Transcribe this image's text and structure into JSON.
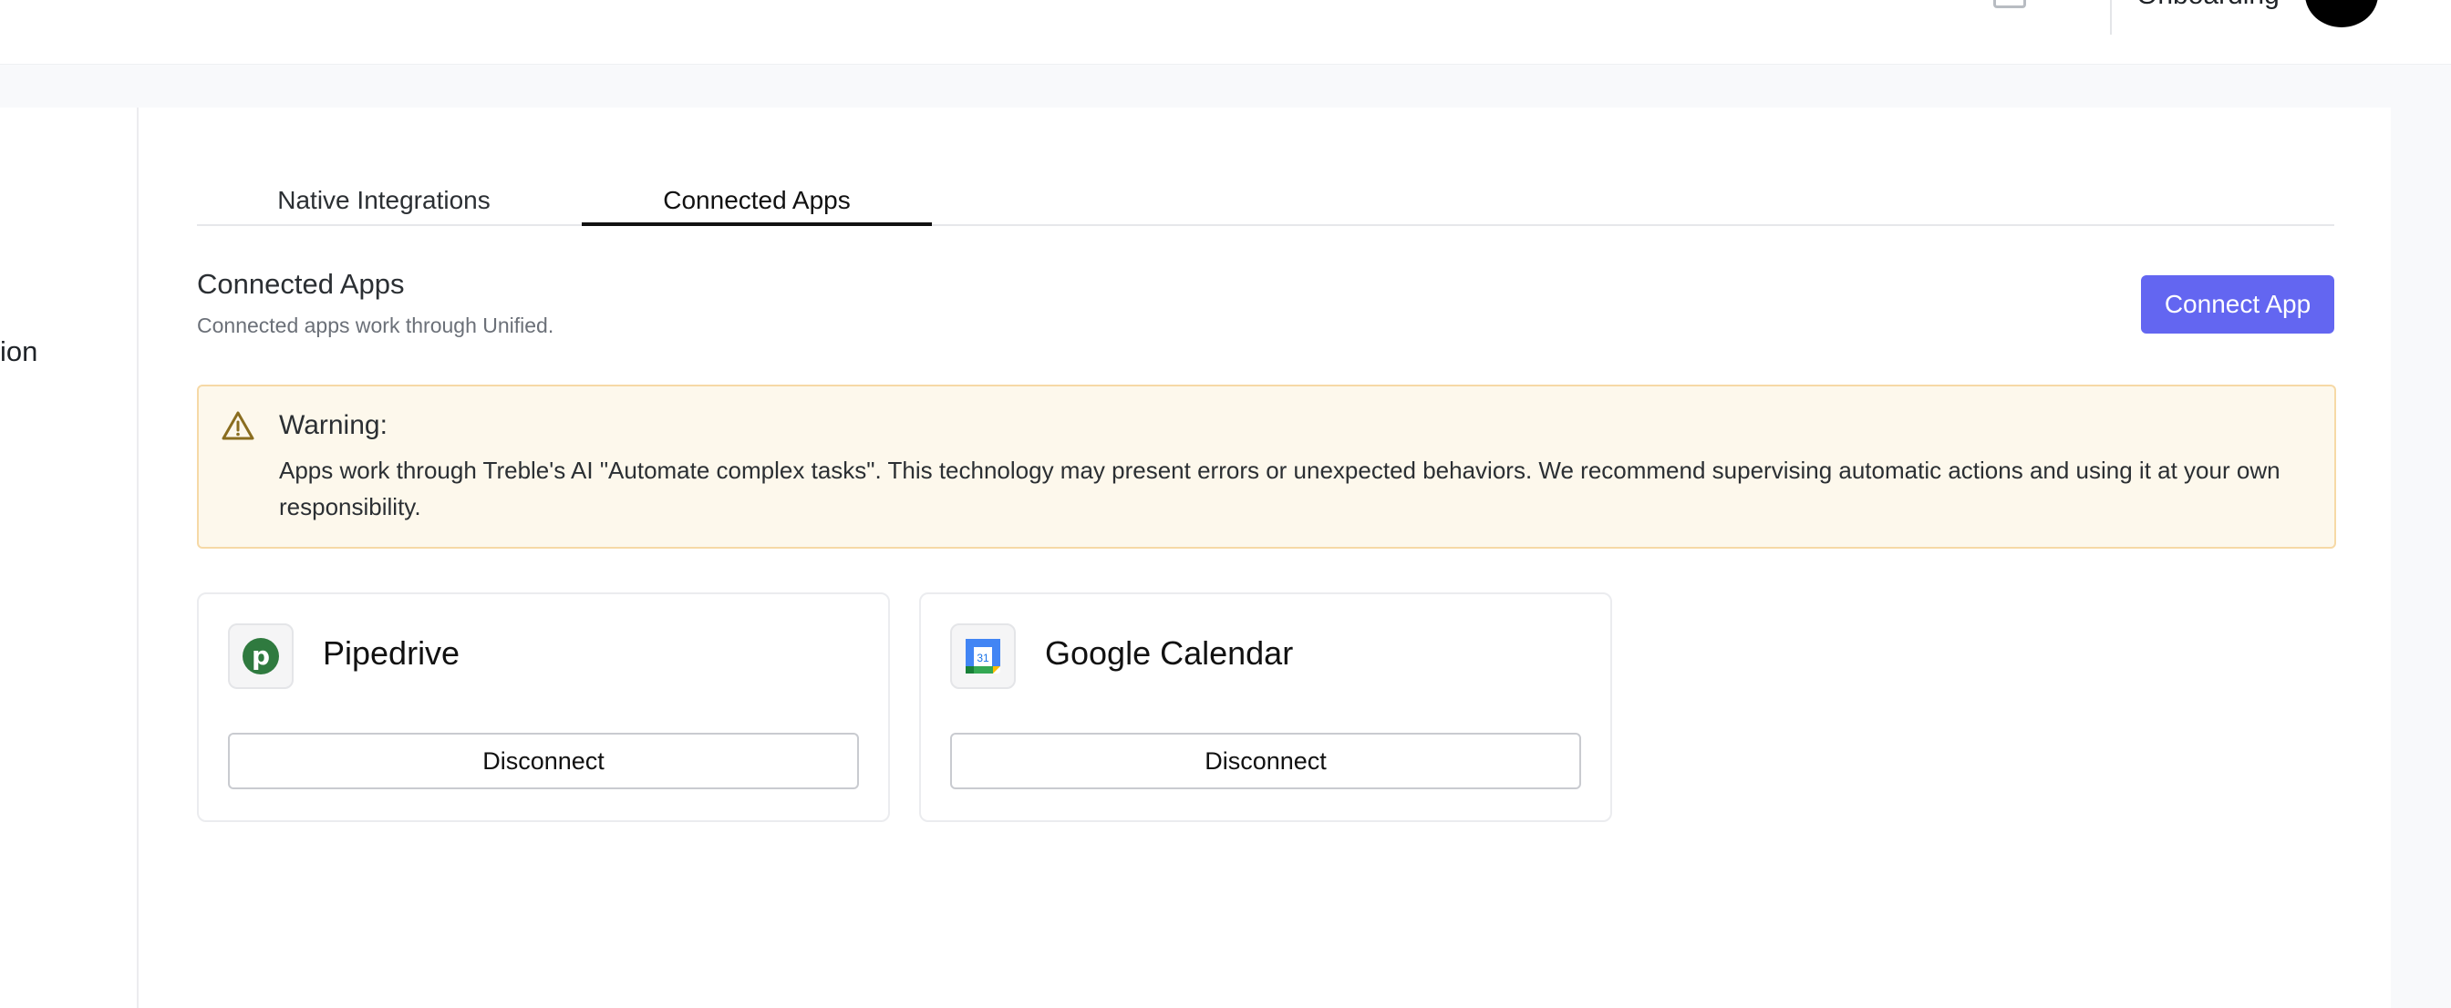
{
  "topbar": {
    "username": "Onboarding",
    "icons": [
      "document-icon",
      "user-avatar"
    ]
  },
  "sidebar": {
    "partial_label": "ion"
  },
  "tabs": [
    {
      "label": "Native Integrations",
      "active": false
    },
    {
      "label": "Connected Apps",
      "active": true
    }
  ],
  "section": {
    "title": "Connected Apps",
    "subtitle": "Connected apps work through Unified.",
    "connect_button": "Connect App"
  },
  "warning": {
    "title": "Warning:",
    "body": "Apps work through Treble's AI \"Automate complex tasks\". This technology may present errors or unexpected behaviors. We recommend supervising automatic actions and using it at your own responsibility."
  },
  "apps": [
    {
      "name": "Pipedrive",
      "button": "Disconnect",
      "logo_letter": "p",
      "logo_icon": "pipedrive-logo-icon"
    },
    {
      "name": "Google Calendar",
      "button": "Disconnect",
      "logo_text": "31",
      "logo_icon": "google-calendar-logo-icon"
    }
  ],
  "colors": {
    "accent": "#6366f1",
    "warning_bg": "#fdf8ec",
    "warning_border": "#f6d9a6",
    "pipedrive_green": "#2f7a3f"
  }
}
